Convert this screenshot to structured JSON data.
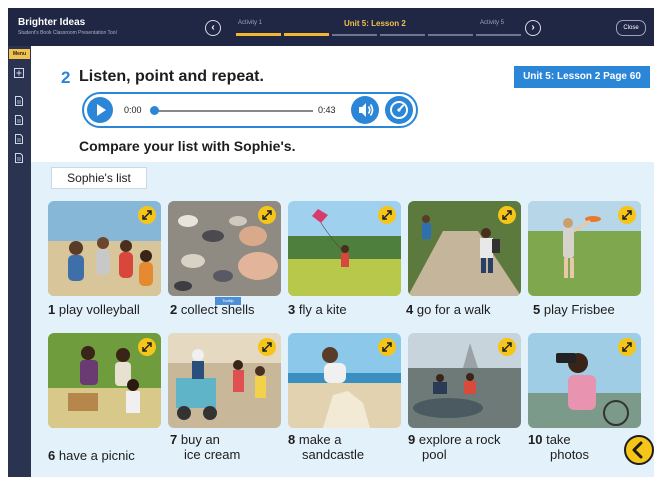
{
  "app": {
    "title": "Brighter Ideas",
    "subtitle": "Student's Book Classroom Presentation Tool"
  },
  "nav": {
    "prev_label": "‹",
    "next_label": "›",
    "steps": [
      {
        "label": "Activity 1",
        "current": false
      },
      {
        "label": "Unit 5: Lesson 2",
        "current": true
      },
      {
        "label": "Activity 5",
        "current": false
      }
    ],
    "progress_segments": [
      true,
      true,
      false,
      false,
      false,
      false
    ],
    "close_label": "Close"
  },
  "sidebar": {
    "menu_label": "Menu",
    "icons": [
      "add-icon",
      "page-icon",
      "page-icon",
      "page-icon",
      "page-icon"
    ]
  },
  "exercise": {
    "number": "2",
    "title": "Listen, point and repeat.",
    "badge": "Unit 5: Lesson 2 Page 60",
    "instruction": "Compare your list with Sophie's.",
    "list_label": "Sophie's list"
  },
  "audio": {
    "current_time": "0:00",
    "duration": "0:43",
    "progress": 0
  },
  "tooltip": "Tooltip",
  "activities": [
    {
      "number": "1",
      "line1": "play volleyball",
      "line2": "",
      "icon": "expand-icon"
    },
    {
      "number": "2",
      "line1": "collect shells",
      "line2": "",
      "icon": "expand-icon"
    },
    {
      "number": "3",
      "line1": "fly a kite",
      "line2": "",
      "icon": "expand-icon"
    },
    {
      "number": "4",
      "line1": "go for a walk",
      "line2": "",
      "icon": "expand-icon"
    },
    {
      "number": "5",
      "line1": "play Frisbee",
      "line2": "",
      "icon": "expand-icon"
    },
    {
      "number": "6",
      "line1": "have a picnic",
      "line2": "",
      "icon": "expand-icon"
    },
    {
      "number": "7",
      "line1": "buy an",
      "line2": "ice cream",
      "icon": "expand-icon"
    },
    {
      "number": "8",
      "line1": "make a",
      "line2": "sandcastle",
      "icon": "expand-icon"
    },
    {
      "number": "9",
      "line1": "explore a rock",
      "line2": "pool",
      "icon": "expand-icon"
    },
    {
      "number": "10",
      "line1": "take",
      "line2": "photos",
      "icon": "expand-icon"
    }
  ],
  "colors": {
    "topbar": "#1f2744",
    "accent_blue": "#2b86d8",
    "accent_yellow": "#f5c518",
    "panel": "#e3f1fb"
  }
}
